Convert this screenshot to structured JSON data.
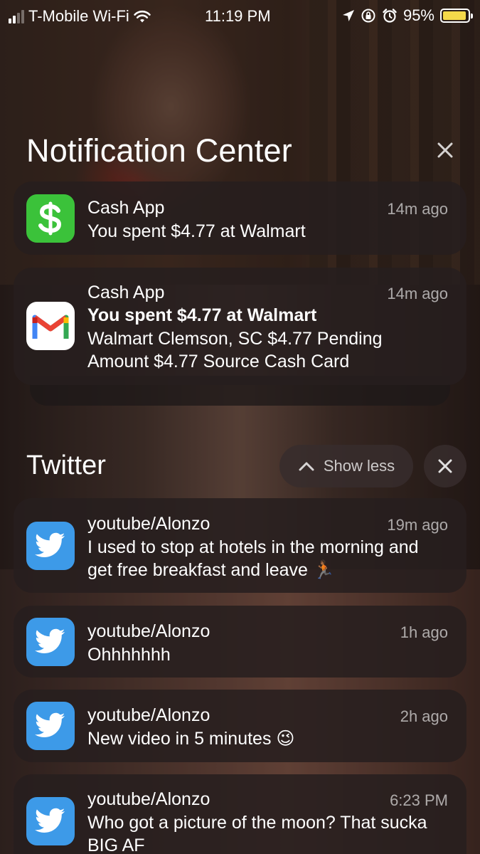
{
  "status_bar": {
    "carrier": "T-Mobile Wi-Fi",
    "time": "11:19 PM",
    "battery_percent": "95%",
    "battery_level": 0.95,
    "icons": [
      "signal-icon",
      "wifi-icon",
      "location-icon",
      "orientation-lock-icon",
      "alarm-icon",
      "battery-icon"
    ]
  },
  "header": {
    "title": "Notification Center",
    "close_icon": "close-icon"
  },
  "top_notifications": [
    {
      "app": "Cash App",
      "icon": "cash-app-icon",
      "time": "14m ago",
      "body": "You spent $4.77 at Walmart"
    },
    {
      "app": "Cash App",
      "icon": "gmail-icon",
      "time": "14m ago",
      "subject": "You spent $4.77 at Walmart",
      "body": "Walmart Clemson, SC $4.77 Pending Amount $4.77 Source Cash Card"
    }
  ],
  "twitter_group": {
    "title": "Twitter",
    "show_less_label": "Show less",
    "items": [
      {
        "sender": "youtube/Alonzo",
        "time": "19m ago",
        "body": "I used to stop at hotels in the morning and get free breakfast and leave 🏃🏾"
      },
      {
        "sender": "youtube/Alonzo",
        "time": "1h ago",
        "body": "Ohhhhhhh"
      },
      {
        "sender": "youtube/Alonzo",
        "time": "2h ago",
        "body": "New video in 5 minutes 😉"
      },
      {
        "sender": "youtube/Alonzo",
        "time": "6:23 PM",
        "body": "Who got a picture of the moon? That sucka BIG AF"
      }
    ]
  }
}
